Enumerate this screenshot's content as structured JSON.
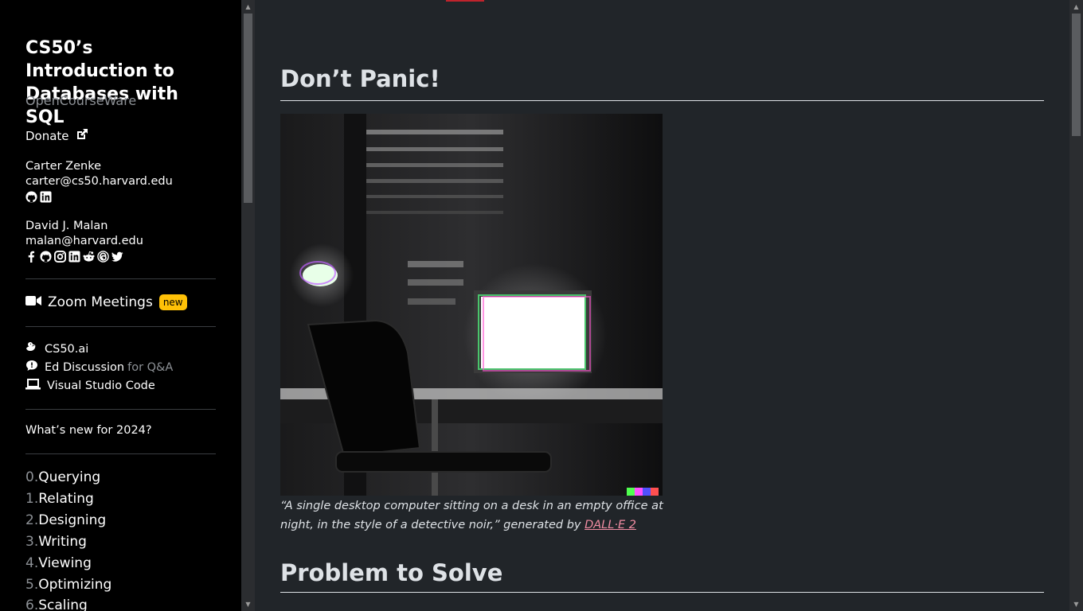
{
  "sidebar": {
    "course_title": "CS50’s Introduction to Databases with SQL",
    "subtitle": "OpenCourseWare",
    "donate_label": "Donate",
    "instructors": [
      {
        "name": "Carter Zenke",
        "email": "carter@cs50.harvard.edu",
        "icons": [
          "github-icon",
          "linkedin-icon"
        ]
      },
      {
        "name": "David J. Malan",
        "email": "malan@harvard.edu",
        "icons": [
          "facebook-icon",
          "github-icon",
          "instagram-icon",
          "linkedin-icon",
          "reddit-icon",
          "threads-icon",
          "twitter-icon"
        ]
      }
    ],
    "zoom_label": "Zoom Meetings",
    "zoom_badge": "new",
    "tools": [
      {
        "label": "CS50.ai",
        "suffix": "",
        "icon": "duck-icon"
      },
      {
        "label": "Ed Discussion",
        "suffix": "for Q&A",
        "icon": "chat-icon"
      },
      {
        "label": "Visual Studio Code",
        "suffix": "",
        "icon": "laptop-icon"
      }
    ],
    "whats_new": "What’s new for 2024?",
    "lectures": [
      {
        "num": "0.",
        "title": "Querying"
      },
      {
        "num": "1.",
        "title": "Relating"
      },
      {
        "num": "2.",
        "title": "Designing"
      },
      {
        "num": "3.",
        "title": "Writing"
      },
      {
        "num": "4.",
        "title": "Viewing"
      },
      {
        "num": "5.",
        "title": "Optimizing"
      },
      {
        "num": "6.",
        "title": "Scaling"
      }
    ]
  },
  "main": {
    "heading1": "Don’t Panic!",
    "caption_text": "“A single desktop computer sitting on a desk in an empty office at night, in the style of a detective noir,” generated by",
    "caption_link": "DALL·E 2",
    "heading2": "Problem to Solve"
  },
  "colors": {
    "sidebar_bg": "#000000",
    "main_bg": "#212529",
    "accent_red": "#c0232c",
    "badge_yellow": "#ffc107",
    "link_pink": "#f08ca2"
  }
}
